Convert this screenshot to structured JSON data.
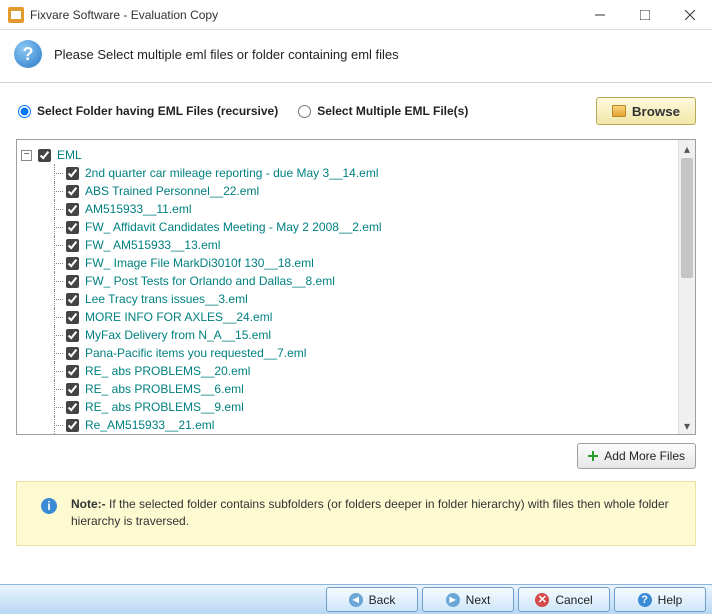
{
  "window": {
    "title": "Fixvare Software - Evaluation Copy"
  },
  "header": {
    "instruction": "Please Select multiple eml files or folder containing eml files"
  },
  "options": {
    "radio_folder": "Select Folder having EML Files (recursive)",
    "radio_files": "Select Multiple EML File(s)",
    "browse_label": "Browse"
  },
  "tree": {
    "root_label": "EML",
    "files": [
      "2nd quarter car mileage reporting - due May 3__14.eml",
      "ABS Trained Personnel__22.eml",
      "AM515933__11.eml",
      "FW_ Affidavit Candidates Meeting - May 2 2008__2.eml",
      "FW_ AM515933__13.eml",
      "FW_ Image File MarkDi3010f 130__18.eml",
      "FW_ Post Tests for Orlando and Dallas__8.eml",
      "Lee Tracy trans issues__3.eml",
      "MORE INFO FOR AXLES__24.eml",
      "MyFax Delivery from N_A__15.eml",
      "Pana-Pacific items you requested__7.eml",
      "RE_ abs PROBLEMS__20.eml",
      "RE_ abs PROBLEMS__6.eml",
      "RE_ abs PROBLEMS__9.eml",
      "Re_AM515933__21.eml"
    ]
  },
  "add_more_label": "Add More Files",
  "note": {
    "prefix": "Note:-",
    "body": "If the selected folder contains subfolders (or folders deeper in folder hierarchy) with files then whole folder hierarchy is traversed."
  },
  "footer": {
    "back": "Back",
    "next": "Next",
    "cancel": "Cancel",
    "help": "Help"
  }
}
